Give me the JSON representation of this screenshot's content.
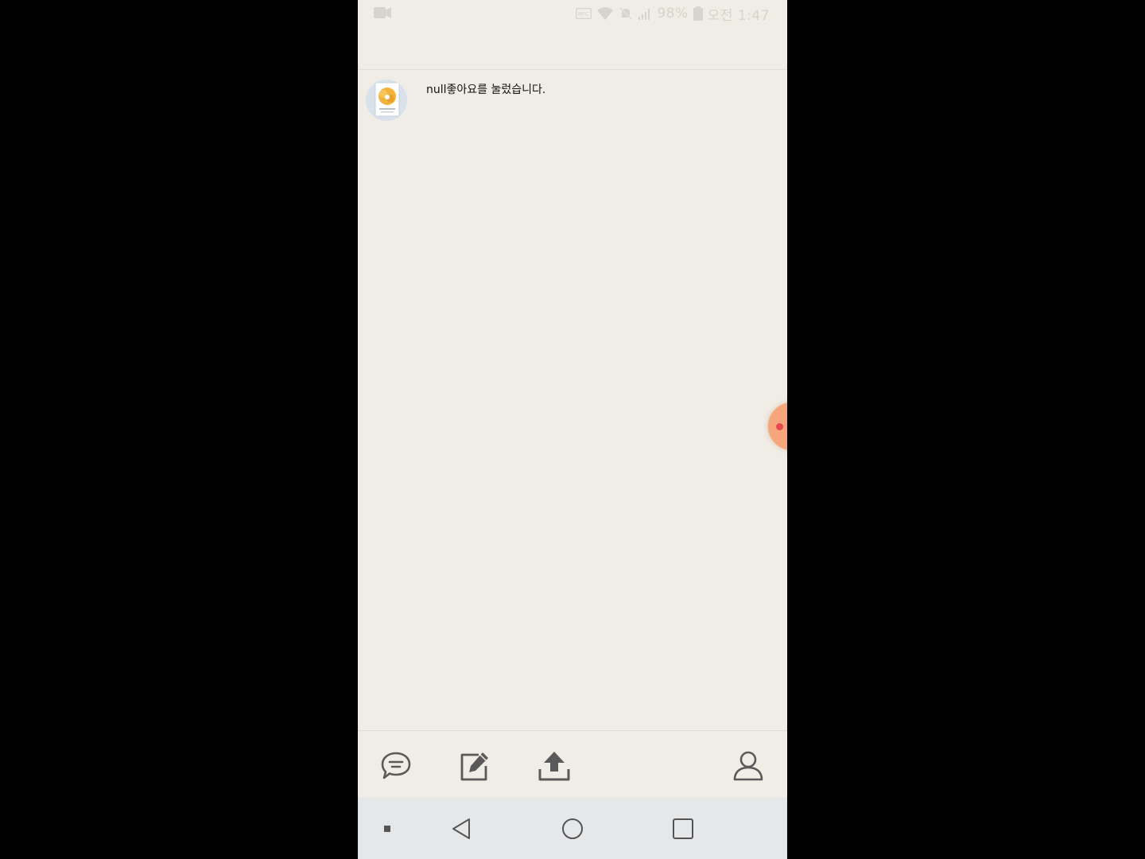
{
  "status_bar": {
    "battery_percent": "98%",
    "time": "오전 1:47",
    "icons": [
      "screen-record-icon",
      "nfc-icon",
      "wifi-icon",
      "mute-icon",
      "signal-icon",
      "battery-icon"
    ]
  },
  "notifications": [
    {
      "text": "null좋아요를 눌렀습니다.",
      "avatar": "book-cover-avatar"
    }
  ],
  "toolbar": {
    "icons": [
      "chat-bubble-icon",
      "edit-icon",
      "upload-icon",
      "profile-icon"
    ]
  },
  "system_nav": {
    "icons": [
      "dot-icon",
      "back-icon",
      "home-icon",
      "recents-icon"
    ]
  },
  "colors": {
    "background": "#efede5",
    "nav_background": "#e6e7e9",
    "icon_gray": "#5a5a5a",
    "bubble": "#f7a57a",
    "bubble_dot": "#e8474f"
  }
}
